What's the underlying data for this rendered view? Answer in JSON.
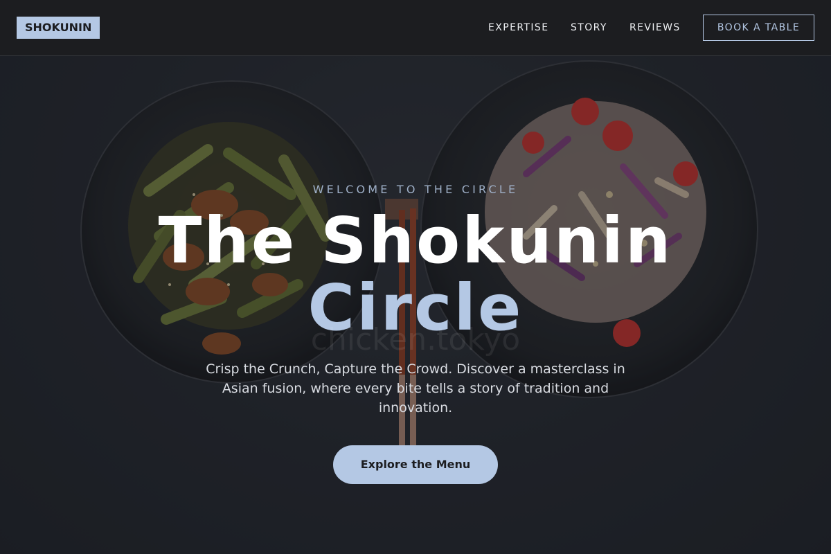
{
  "header": {
    "logo": "SHOKUNIN",
    "nav": [
      {
        "label": "EXPERTISE"
      },
      {
        "label": "STORY"
      },
      {
        "label": "REVIEWS"
      }
    ],
    "book_label": "BOOK A TABLE"
  },
  "hero": {
    "eyebrow": "WELCOME TO THE CIRCLE",
    "title_line1": "The Shokunin",
    "title_line2": "Circle",
    "watermark": "chicken.tokyo",
    "subtitle": "Crisp the Crunch, Capture the Crowd. Discover a masterclass in Asian fusion, where every bite tells a story of tradition and innovation.",
    "cta_label": "Explore the Menu"
  },
  "colors": {
    "accent": "#b4c8e4",
    "header_bg": "#1c1d20",
    "hero_bg": "#24272e"
  }
}
